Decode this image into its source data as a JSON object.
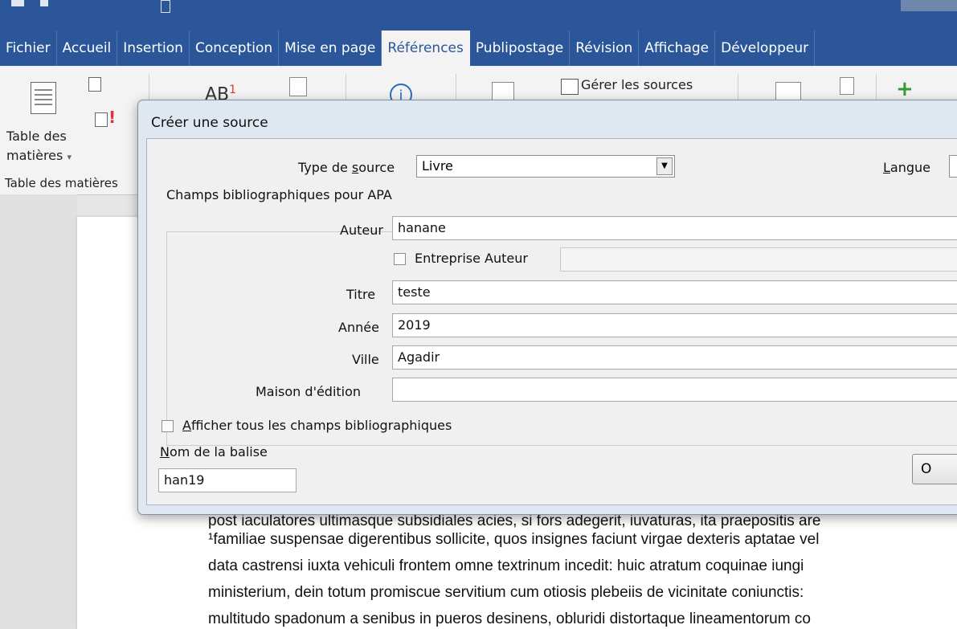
{
  "ribbon_tabs": [
    "Fichier",
    "Accueil",
    "Insertion",
    "Conception",
    "Mise en page",
    "Références",
    "Publipostage",
    "Révision",
    "Affichage",
    "Développeur"
  ],
  "ribbon": {
    "toc_label_1": "Table des",
    "toc_label_2": "matières",
    "toc_dropdown": "▾",
    "toc_group": "Table des matières",
    "ab_text": "AB",
    "ab_sup": "1",
    "manage_sources": "Gérer les sources"
  },
  "dialog": {
    "title": "Créer une source",
    "source_type_label_pre": "Type de ",
    "source_type_label_u": "s",
    "source_type_label_post": "ource",
    "source_type_value": "Livre",
    "language_label_u": "L",
    "language_label_post": "angue",
    "biblio_group": "Champs bibliographiques pour APA",
    "fields": {
      "author_label": "Auteur",
      "author_value": "hanane",
      "corporate_author_label": "Entreprise Auteur",
      "title_label": "Titre",
      "title_value": "teste",
      "year_label": "Année",
      "year_value": "2019",
      "city_label": "Ville",
      "city_value": "Agadir",
      "publisher_label": "Maison d'édition",
      "publisher_value": ""
    },
    "show_all_u": "A",
    "show_all_post": "fficher tous les champs bibliographiques",
    "tag_label_u": "N",
    "tag_label_post": "om de la balise",
    "tag_value": "han19",
    "ok_button": "O"
  },
  "document_lines": [
    "¹familiae suspensae digerentibus sollicite, quos insignes faciunt virgae dexteris aptatae vel",
    "data castrensi iuxta vehiculi frontem omne textrinum incedit: huic atratum coquinae iungi",
    "ministerium, dein totum promiscue servitium cum otiosis plebeiis de vicinitate coniunctis:",
    "multitudo spadonum a senibus in pueros desinens, obluridi distortaque lineamentorum co"
  ],
  "document_partial_line": "post iaculatores ultimasque subsidiales acies, si fors adegerit, iuvaturas, ita praepositis are"
}
